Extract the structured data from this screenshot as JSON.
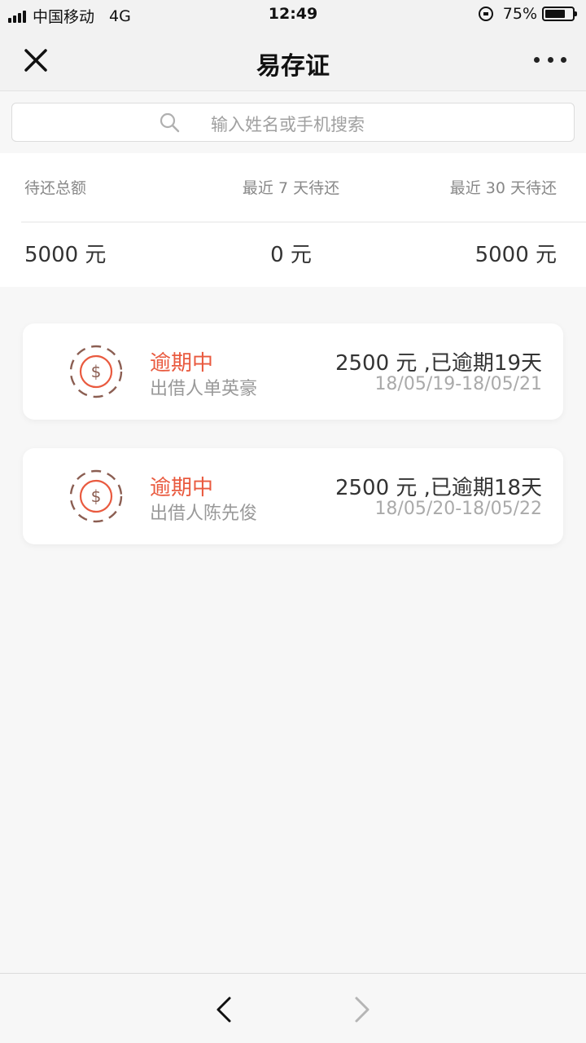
{
  "status_bar": {
    "carrier": "中国移动",
    "network": "4G",
    "time": "12:49",
    "battery_percent_text": "75%",
    "battery_level": 0.75
  },
  "nav": {
    "title": "易存证",
    "close_icon": "close-icon",
    "more_icon": "more-dots-icon"
  },
  "search": {
    "placeholder": "输入姓名或手机搜索",
    "icon": "search-icon"
  },
  "summary": {
    "labels": [
      "待还总额",
      "最近 7 天待还",
      "最近 30 天待还"
    ],
    "values": [
      "5000 元",
      "0 元",
      "5000 元"
    ]
  },
  "records": [
    {
      "status": "逾期中",
      "lender": "出借人单英豪",
      "amount": "2500 元 ,已逾期19天",
      "dates": "18/05/19-18/05/21",
      "icon": "dollar-coin-icon"
    },
    {
      "status": "逾期中",
      "lender": "出借人陈先俊",
      "amount": "2500 元 ,已逾期18天",
      "dates": "18/05/20-18/05/22",
      "icon": "dollar-coin-icon"
    }
  ],
  "colors": {
    "accent": "#e95a3f",
    "coin_ring": "#8b5e52"
  },
  "bottom_nav": {
    "back_icon": "chevron-left-icon",
    "forward_icon": "chevron-right-icon"
  }
}
